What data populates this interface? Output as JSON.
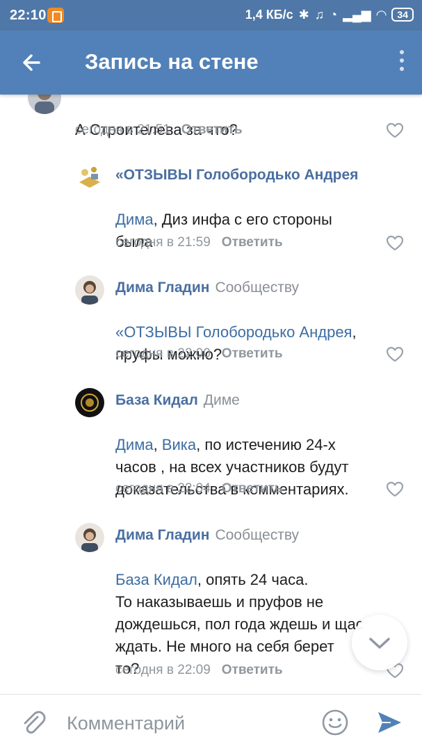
{
  "status_bar": {
    "time": "22:10",
    "speed": "1,4 КБ/с",
    "battery": "34"
  },
  "toolbar": {
    "title": "Запись на стене"
  },
  "comments": [
    {
      "author": "",
      "reply_to": "",
      "text": "А Строителева за что?",
      "time": "сегодня в 21:51",
      "reply_label": "Ответить"
    },
    {
      "author": "«ОТЗЫВЫ Голобородько Андрея",
      "reply_to": "",
      "mentions": [
        "Дима"
      ],
      "text": ", Диз инфа с его стороны\nбыла",
      "time": "сегодня в 21:59",
      "reply_label": "Ответить"
    },
    {
      "author": "Дима Гладин",
      "reply_to": "Сообществу",
      "mentions": [
        "«ОТЗЫВЫ Голобородько Андрея"
      ],
      "text": ",\nпруфы можно?",
      "time": "сегодня в 22:00",
      "reply_label": "Ответить"
    },
    {
      "author": "База Кидал",
      "reply_to": "Диме",
      "mentions": [
        "Дима",
        "Вика"
      ],
      "separator": ", ",
      "text": ", по истечению 24-х\nчасов , на всех участников будут\nдоказательства в комментариях.",
      "time": "сегодня в 22:04",
      "reply_label": "Ответить"
    },
    {
      "author": "Дима Гладин",
      "reply_to": "Сообществу",
      "mentions": [
        "База Кидал"
      ],
      "text": ", опять 24 часа.\nТо наказываешь и пруфов не\nдождешься, пол года ждешь и щас\nждать. Не много на себя берет\nто?",
      "time": "сегодня в 22:09",
      "reply_label": "Ответить"
    }
  ],
  "input": {
    "placeholder": "Комментарий"
  },
  "icons": {
    "back": "back-arrow-icon",
    "menu": "more-vertical-icon",
    "like": "heart-icon",
    "attach": "paperclip-icon",
    "emoji": "smile-icon",
    "send": "send-icon",
    "scroll": "chevron-down-icon"
  },
  "colors": {
    "header": "#5181b8",
    "status_bar": "#4f78a8",
    "link": "#3c6da3",
    "author": "#4a6fa0",
    "meta": "#8f969d",
    "send": "#5181b8"
  }
}
